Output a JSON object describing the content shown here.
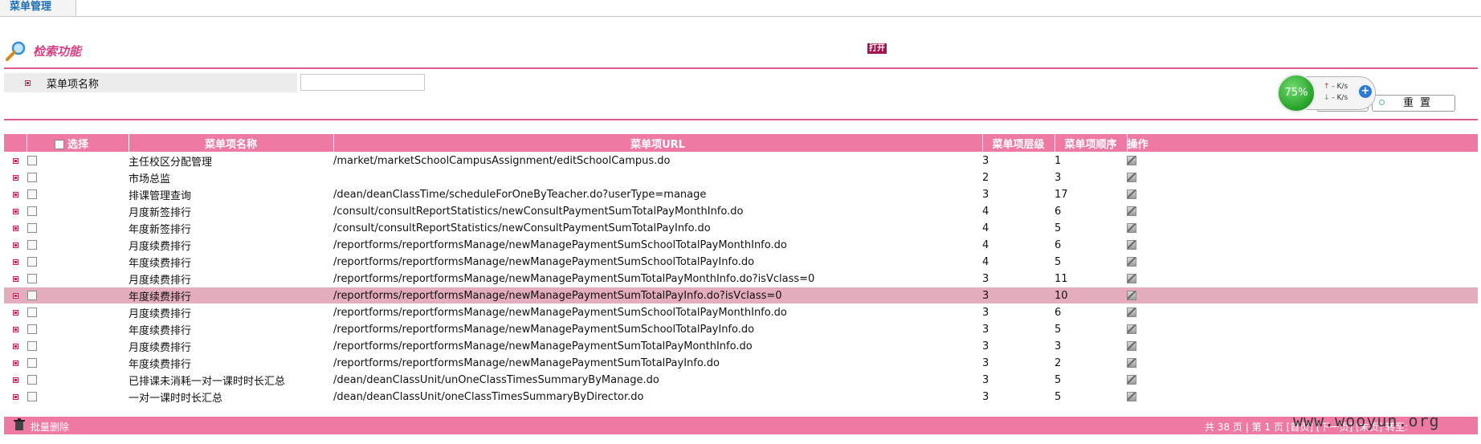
{
  "tab": {
    "label": "菜单管理"
  },
  "search": {
    "title": "检索功能",
    "open_label": "打开",
    "field_label": "菜单项名称",
    "field_value": "",
    "search_button": "",
    "reset_button": "重置"
  },
  "net_widget": {
    "percent": "75%",
    "up": "- K/s",
    "down": "- K/s"
  },
  "table": {
    "headers": {
      "select": "选择",
      "name": "菜单项名称",
      "url": "菜单项URL",
      "level": "菜单项层级",
      "order": "菜单项顺序",
      "action": "操作"
    },
    "rows": [
      {
        "name": "主任校区分配管理",
        "url": "/market/marketSchoolCampusAssignment/editSchoolCampus.do",
        "level": "3",
        "order": "1"
      },
      {
        "name": "市场总监",
        "url": "",
        "level": "2",
        "order": "3"
      },
      {
        "name": "排课管理查询",
        "url": "/dean/deanClassTime/scheduleForOneByTeacher.do?userType=manage",
        "level": "3",
        "order": "17"
      },
      {
        "name": "月度新签排行",
        "url": "/consult/consultReportStatistics/newConsultPaymentSumTotalPayMonthInfo.do",
        "level": "4",
        "order": "6"
      },
      {
        "name": "年度新签排行",
        "url": "/consult/consultReportStatistics/newConsultPaymentSumTotalPayInfo.do",
        "level": "4",
        "order": "5"
      },
      {
        "name": "月度续费排行",
        "url": "/reportforms/reportformsManage/newManagePaymentSumSchoolTotalPayMonthInfo.do",
        "level": "4",
        "order": "6"
      },
      {
        "name": "年度续费排行",
        "url": "/reportforms/reportformsManage/newManagePaymentSumSchoolTotalPayInfo.do",
        "level": "4",
        "order": "5"
      },
      {
        "name": "月度续费排行",
        "url": "/reportforms/reportformsManage/newManagePaymentSumTotalPayMonthInfo.do?isVclass=0",
        "level": "3",
        "order": "11"
      },
      {
        "name": "年度续费排行",
        "url": "/reportforms/reportformsManage/newManagePaymentSumTotalPayInfo.do?isVclass=0",
        "level": "3",
        "order": "10",
        "highlight": true
      },
      {
        "name": "月度续费排行",
        "url": "/reportforms/reportformsManage/newManagePaymentSumSchoolTotalPayMonthInfo.do",
        "level": "3",
        "order": "6"
      },
      {
        "name": "年度续费排行",
        "url": "/reportforms/reportformsManage/newManagePaymentSumSchoolTotalPayInfo.do",
        "level": "3",
        "order": "5"
      },
      {
        "name": "月度续费排行",
        "url": "/reportforms/reportformsManage/newManagePaymentSumTotalPayMonthInfo.do",
        "level": "3",
        "order": "3"
      },
      {
        "name": "年度续费排行",
        "url": "/reportforms/reportformsManage/newManagePaymentSumTotalPayInfo.do",
        "level": "3",
        "order": "2"
      },
      {
        "name": "已排课未消耗一对一课时时长汇总",
        "url": "/dean/deanClassUnit/unOneClassTimesSummaryByManage.do",
        "level": "3",
        "order": "5"
      },
      {
        "name": "一对一课时时长汇总",
        "url": "/dean/deanClassUnit/oneClassTimesSummaryByDirector.do",
        "level": "3",
        "order": "5"
      }
    ]
  },
  "footer": {
    "batch_delete": "批量删除",
    "pager_text": "共 38 页 | 第 1 页 [首页] [下一页] [末页] 转至:"
  },
  "watermark": "www.wooyun.org",
  "colors": {
    "accent_pink": "#ee7aa3",
    "rule_pink": "#e05a92",
    "title_pink": "#d43f82",
    "tab_blue": "#1a6fb8"
  }
}
